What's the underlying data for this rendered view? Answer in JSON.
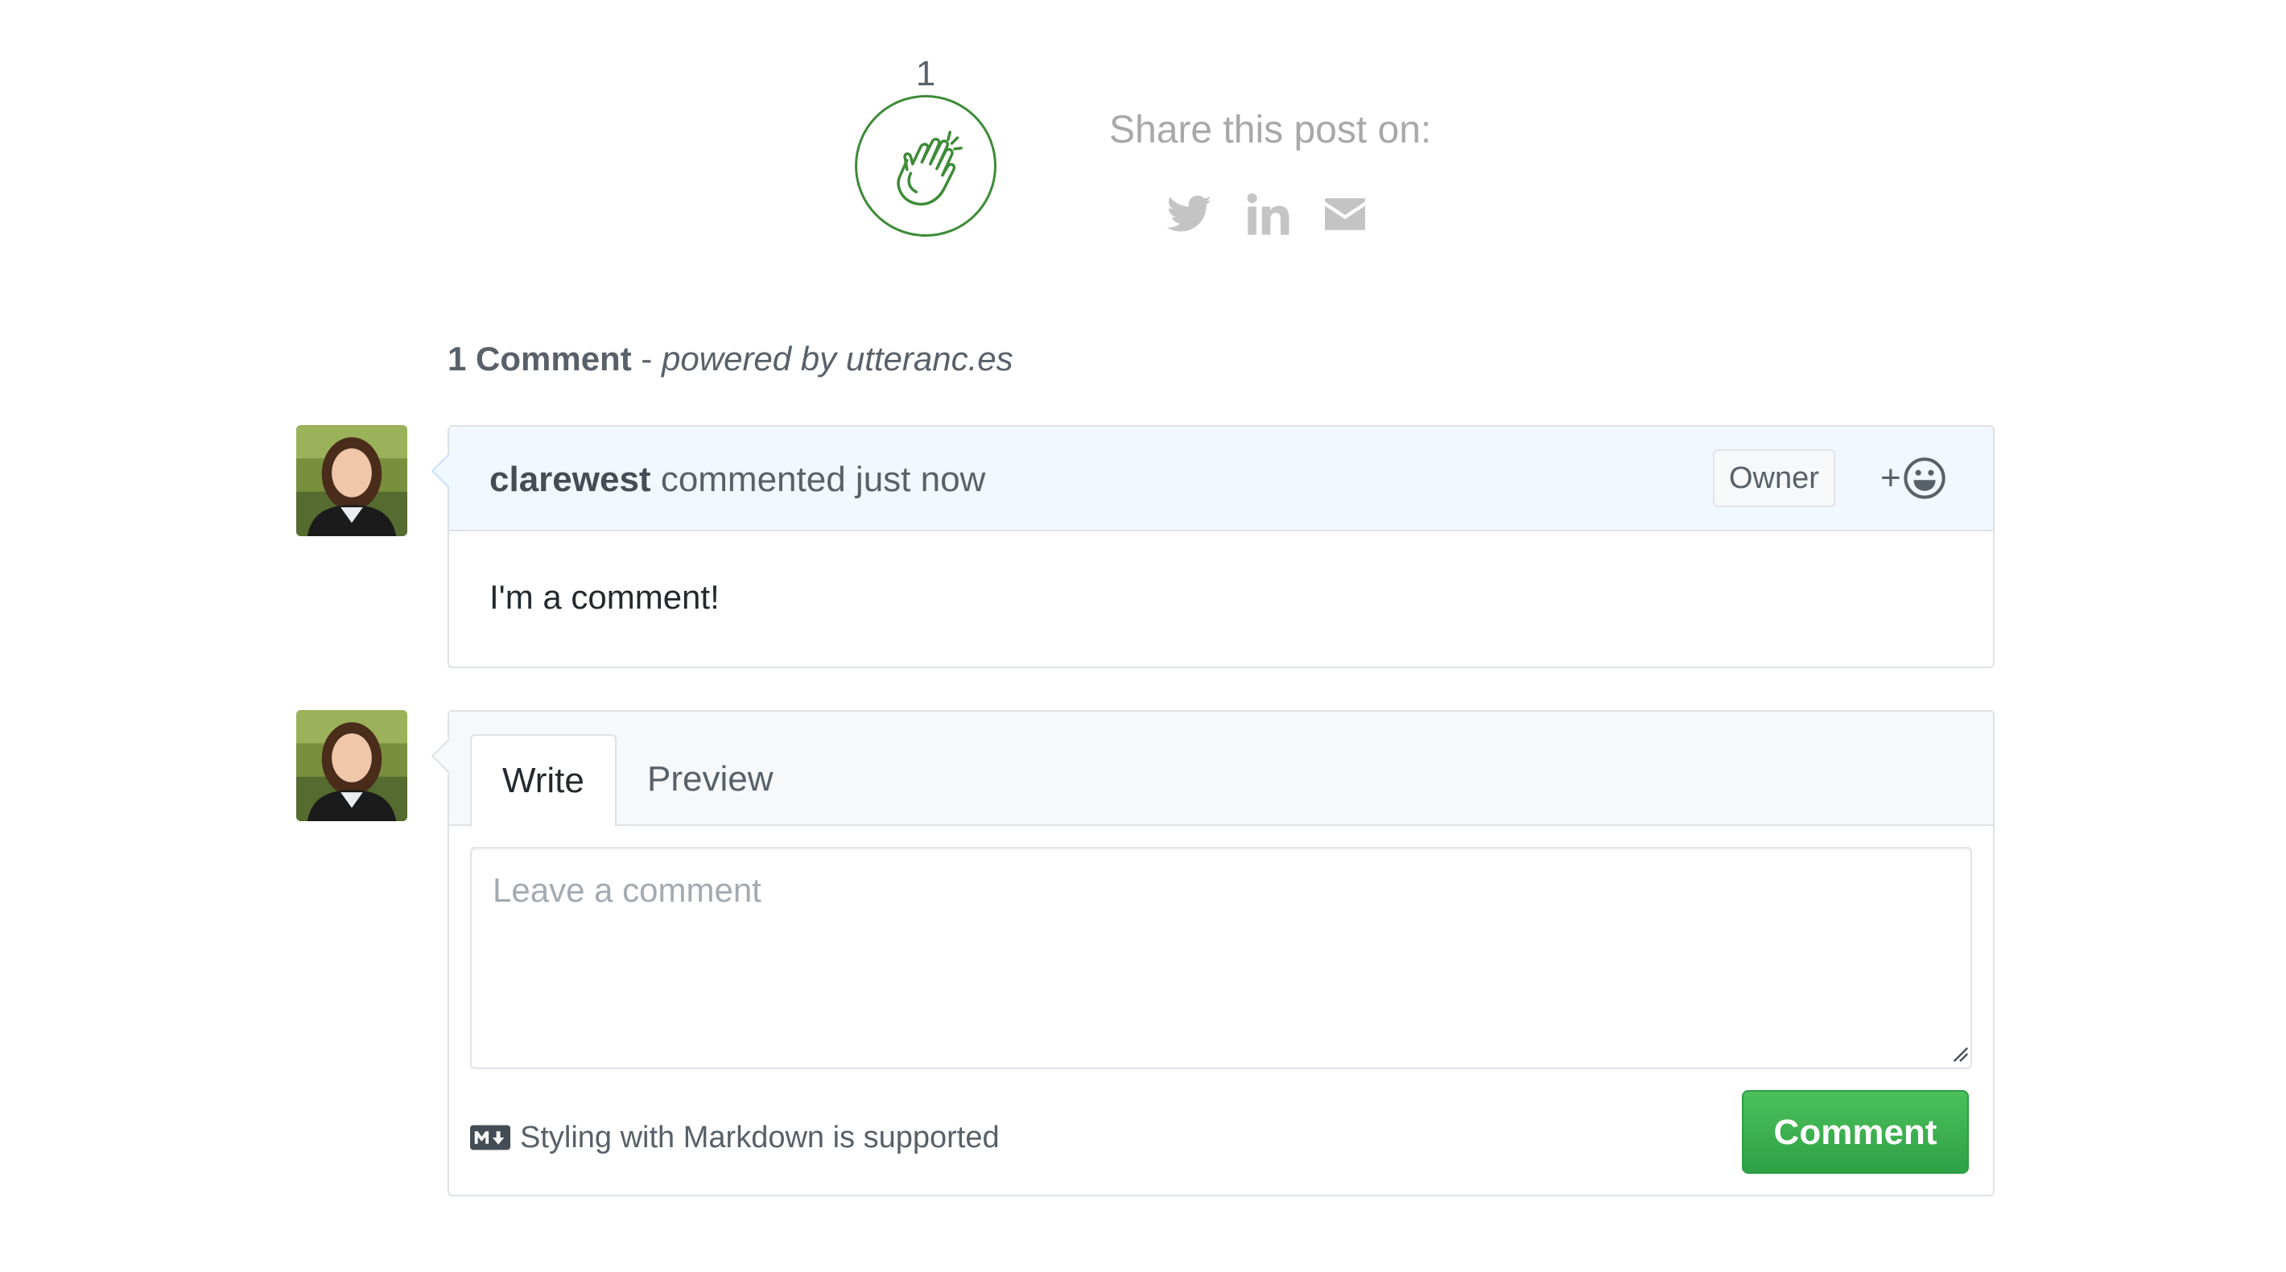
{
  "clap": {
    "count": "1",
    "icon": "clapping-hands-icon",
    "color": "#3d8b37"
  },
  "share": {
    "title": "Share this post on:",
    "icons": [
      "twitter-icon",
      "linkedin-icon",
      "email-icon"
    ],
    "icon_color": "#c4c4c4"
  },
  "comments": {
    "count_label": "1 Comment",
    "separator": " - ",
    "powered_by": "powered by utteranc.es",
    "items": [
      {
        "author": "clarewest",
        "action": "commented just now",
        "badge": "Owner",
        "reaction_plus": "+",
        "reaction_icon": "smiley-icon",
        "body": "I'm a comment!"
      }
    ]
  },
  "form": {
    "tabs": [
      "Write",
      "Preview"
    ],
    "active_tab": "Write",
    "textarea": {
      "placeholder": "Leave a comment",
      "value": ""
    },
    "markdown_note": "Styling with Markdown is supported",
    "submit_label": "Comment",
    "submit_color": "#2ea44f"
  }
}
